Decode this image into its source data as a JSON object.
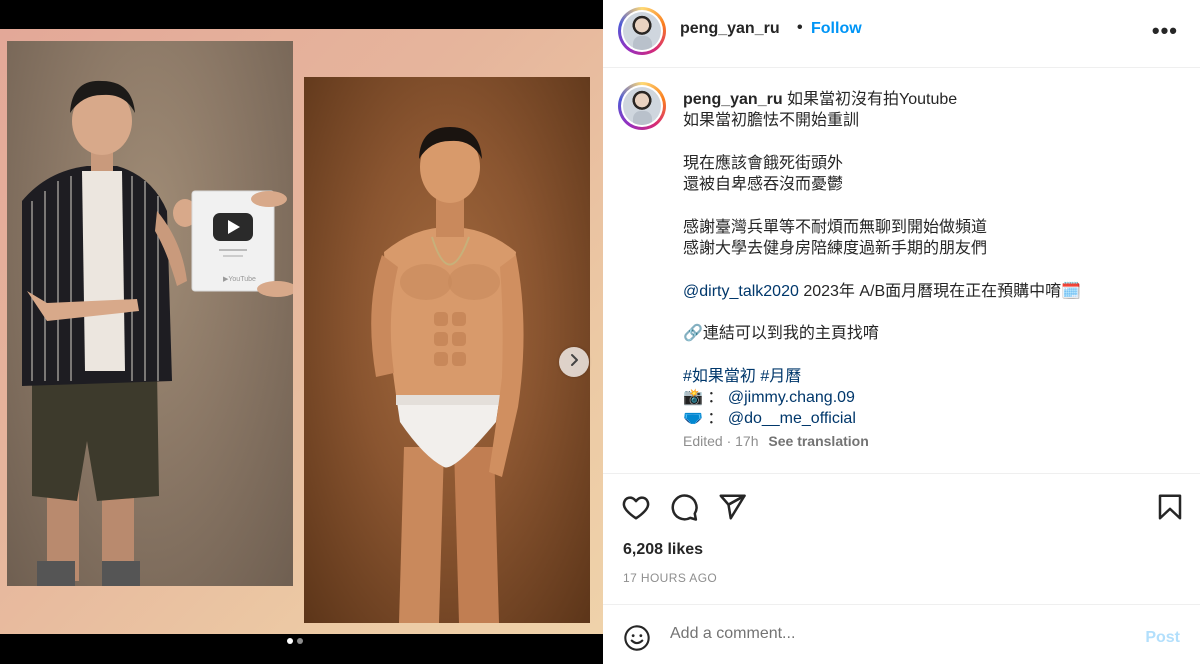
{
  "post": {
    "username": "peng_yan_ru",
    "follow_label": "Follow",
    "separator": "•",
    "more_label": "•••"
  },
  "media": {
    "carousel_dots": 2,
    "active_dot": 0
  },
  "caption": {
    "username": "peng_yan_ru",
    "lines": [
      "如果當初沒有拍Youtube",
      "如果當初膽怯不開始重訓",
      "",
      "現在應該會餓死街頭外",
      "還被自卑感吞沒而憂鬱",
      "",
      "感謝臺灣兵單等不耐煩而無聊到開始做頻道",
      "感謝大學去健身房陪練度過新手期的朋友們",
      "",
      "2023年 A/B面月曆現在正在預購中唷🗓️",
      "",
      "🔗連結可以到我的主頁找唷",
      ""
    ],
    "mention_calendar": "@dirty_talk2020",
    "hashtags": "#如果當初 #月曆",
    "credit_photo_emoji": "📸",
    "credit_photo_sep": "：",
    "credit_photo_handle": "@jimmy.chang.09",
    "credit_outfit_emoji": "🩲",
    "credit_outfit_sep": "：",
    "credit_outfit_handle": "@do__me_official",
    "edited": "Edited · 17h",
    "see_translation": "See translation"
  },
  "engagement": {
    "likes": "6,208 likes",
    "time_ago": "17 HOURS AGO"
  },
  "comment": {
    "placeholder": "Add a comment...",
    "post_label": "Post"
  },
  "colors": {
    "accent": "#0095f6",
    "link": "#00376b",
    "post_disabled": "#b2dffc",
    "muted": "#8e8e8e"
  }
}
